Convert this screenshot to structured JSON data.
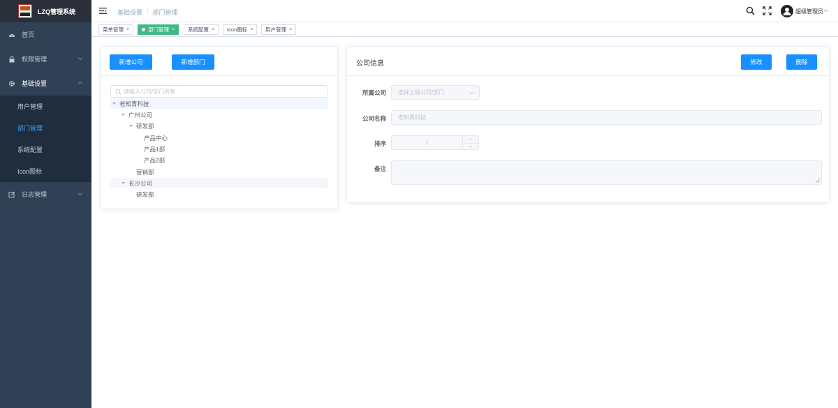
{
  "app": {
    "title": "LZQ管理系统"
  },
  "sidebar": {
    "items": [
      {
        "label": "首页",
        "icon": "dashboard-icon"
      },
      {
        "label": "权限管理",
        "icon": "lock-icon"
      },
      {
        "label": "基础设置",
        "icon": "gear-icon"
      }
    ],
    "submenu": [
      "用户管理",
      "部门管理",
      "系统配置",
      "Icon图标"
    ],
    "active_submenu": "部门管理",
    "last_item": {
      "label": "日志管理",
      "icon": "edit-icon"
    }
  },
  "header": {
    "breadcrumb": [
      "基础设置",
      "部门管理"
    ],
    "separator": "/",
    "username": "超级管理员"
  },
  "tags": [
    {
      "label": "菜单管理",
      "active": false
    },
    {
      "label": "部门管理",
      "active": true
    },
    {
      "label": "系统配置",
      "active": false
    },
    {
      "label": "Icon图标",
      "active": false
    },
    {
      "label": "用户管理",
      "active": false
    }
  ],
  "tag_close": "×",
  "left_panel": {
    "add_company_label": "新增公司",
    "add_department_label": "新增部门",
    "search_placeholder": "请输入公司/部门名称",
    "tree": [
      "老知青科技",
      "广州公司",
      "研发部",
      "产品中心",
      "产品1部",
      "产品2部",
      "营销部",
      "长沙公司",
      "研发部"
    ]
  },
  "right_panel": {
    "title": "公司信息",
    "edit_label": "修改",
    "delete_label": "删除",
    "fields": {
      "parent_label": "所属公司",
      "parent_placeholder": "选择上级公司/部门",
      "name_label": "公司名称",
      "name_value": "老知青科技",
      "sort_label": "排序",
      "sort_value": "1",
      "remark_label": "备注",
      "remark_value": ""
    }
  },
  "colors": {
    "sidebar_bg": "#304156",
    "submenu_bg": "#1f2d3d",
    "primary": "#1890ff",
    "tag_active": "#42b983",
    "active_text": "#409eff"
  }
}
